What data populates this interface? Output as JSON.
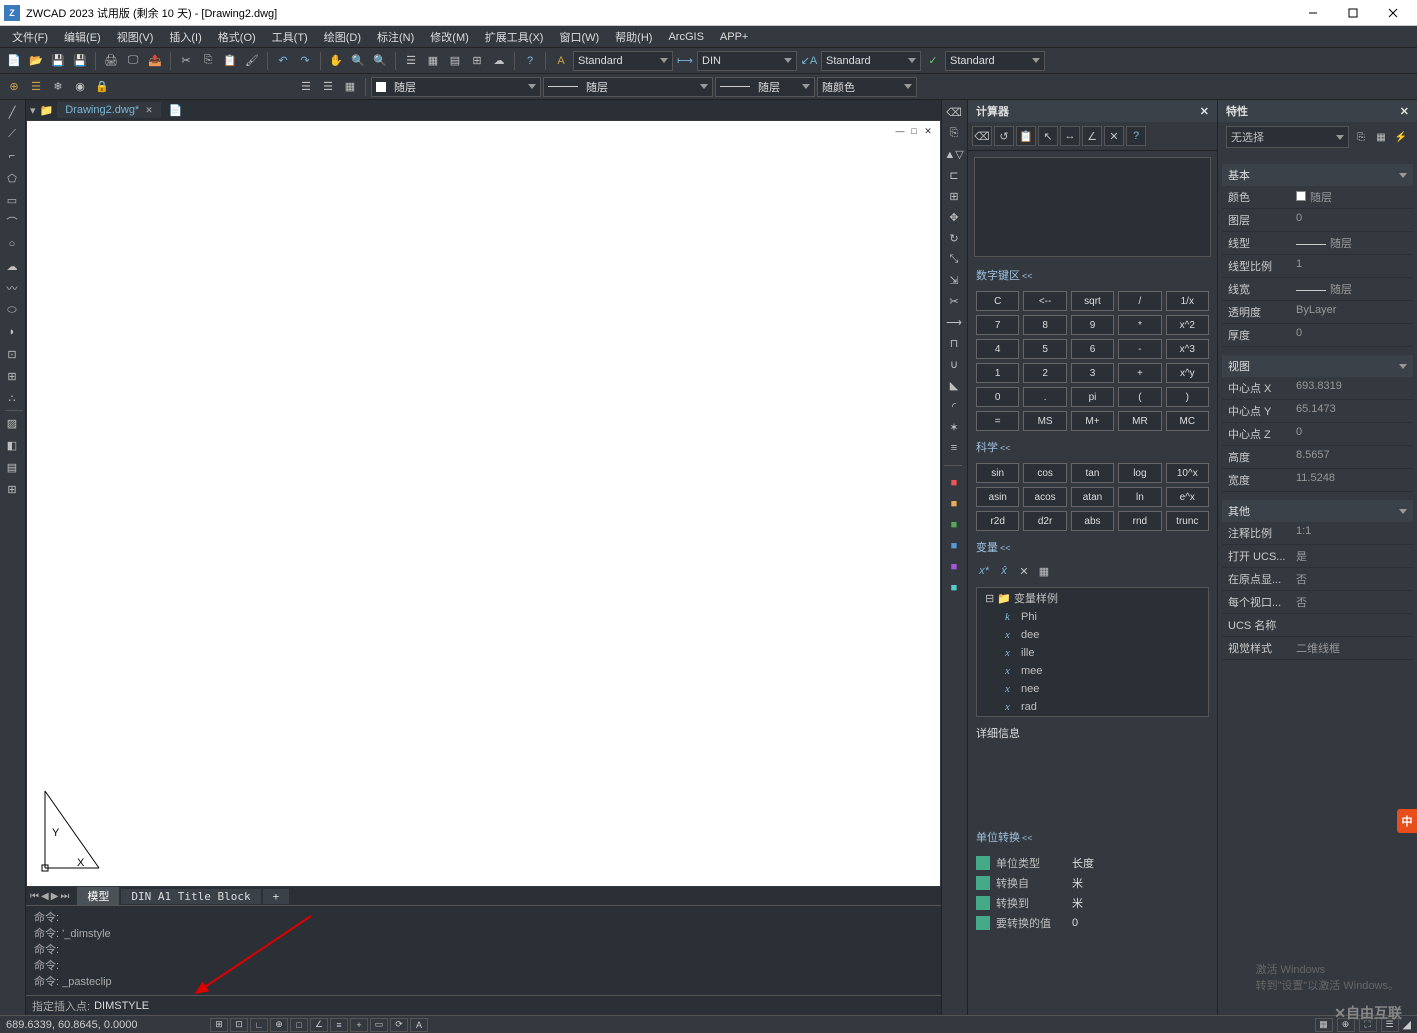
{
  "title": "ZWCAD 2023 试用版 (剩余 10 天) - [Drawing2.dwg]",
  "menus": [
    "文件(F)",
    "编辑(E)",
    "视图(V)",
    "插入(I)",
    "格式(O)",
    "工具(T)",
    "绘图(D)",
    "标注(N)",
    "修改(M)",
    "扩展工具(X)",
    "窗口(W)",
    "帮助(H)",
    "ArcGIS",
    "APP+"
  ],
  "styles": {
    "textLabel": "Standard",
    "dimLabel": "DIN",
    "mleaderLabel": "Standard",
    "tableLabel": "Standard"
  },
  "layerRow": {
    "layer": "随层",
    "linetype": "随层",
    "lineweight": "随层",
    "color": "随颜色"
  },
  "tab": "Drawing2.dwg*",
  "layoutTabs": {
    "model": "模型",
    "layout1": "DIN A1 Title Block",
    "add": "+"
  },
  "cmd": {
    "lines": [
      "命令:",
      "命令: '_dimstyle",
      "命令:",
      "命令:",
      "命令: _pasteclip"
    ],
    "prompt": "指定插入点:",
    "input": "DIMSTYLE"
  },
  "calculator": {
    "title": "计算器",
    "sectionNum": "数字键区",
    "sectionSci": "科学",
    "sectionVar": "变量",
    "keysNum": [
      "C",
      "<--",
      "sqrt",
      "/",
      "1/x",
      "7",
      "8",
      "9",
      "*",
      "x^2",
      "4",
      "5",
      "6",
      "-",
      "x^3",
      "1",
      "2",
      "3",
      "+",
      "x^y",
      "0",
      ".",
      "pi",
      "(",
      ")",
      "=",
      "MS",
      "M+",
      "MR",
      "MC"
    ],
    "keysSci": [
      "sin",
      "cos",
      "tan",
      "log",
      "10^x",
      "asin",
      "acos",
      "atan",
      "ln",
      "e^x",
      "r2d",
      "d2r",
      "abs",
      "rnd",
      "trunc"
    ],
    "varRoot": "变量样例",
    "vars": [
      "Phi",
      "dee",
      "ille",
      "mee",
      "nee",
      "rad"
    ],
    "detail": "详细信息",
    "unitSection": "单位转换",
    "units": [
      {
        "label": "单位类型",
        "value": "长度"
      },
      {
        "label": "转换自",
        "value": "米"
      },
      {
        "label": "转换到",
        "value": "米"
      },
      {
        "label": "要转换的值",
        "value": "0"
      }
    ]
  },
  "props": {
    "title": "特性",
    "selector": "无选择",
    "cat1": "基本",
    "basic": [
      {
        "name": "颜色",
        "value": "随层",
        "swatch": true
      },
      {
        "name": "图层",
        "value": "0"
      },
      {
        "name": "线型",
        "value": "随层",
        "line": true
      },
      {
        "name": "线型比例",
        "value": "1"
      },
      {
        "name": "线宽",
        "value": "随层",
        "line": true
      },
      {
        "name": "透明度",
        "value": "ByLayer"
      },
      {
        "name": "厚度",
        "value": "0"
      }
    ],
    "cat2": "视图",
    "view": [
      {
        "name": "中心点 X",
        "value": "693.8319"
      },
      {
        "name": "中心点 Y",
        "value": "65.1473"
      },
      {
        "name": "中心点 Z",
        "value": "0"
      },
      {
        "name": "高度",
        "value": "8.5657"
      },
      {
        "name": "宽度",
        "value": "11.5248"
      }
    ],
    "cat3": "其他",
    "other": [
      {
        "name": "注释比例",
        "value": "1:1"
      },
      {
        "name": "打开 UCS...",
        "value": "是"
      },
      {
        "name": "在原点显...",
        "value": "否"
      },
      {
        "name": "每个视口...",
        "value": "否"
      },
      {
        "name": "UCS 名称",
        "value": ""
      },
      {
        "name": "视觉样式",
        "value": "二维线框"
      }
    ]
  },
  "status": {
    "coords": "689.6339, 60.8645, 0.0000"
  },
  "watermark": {
    "line1": "激活 Windows",
    "line2": "转到\"设置\"以激活 Windows。"
  },
  "imeBadge": "中",
  "logoText": "✕自由互联"
}
